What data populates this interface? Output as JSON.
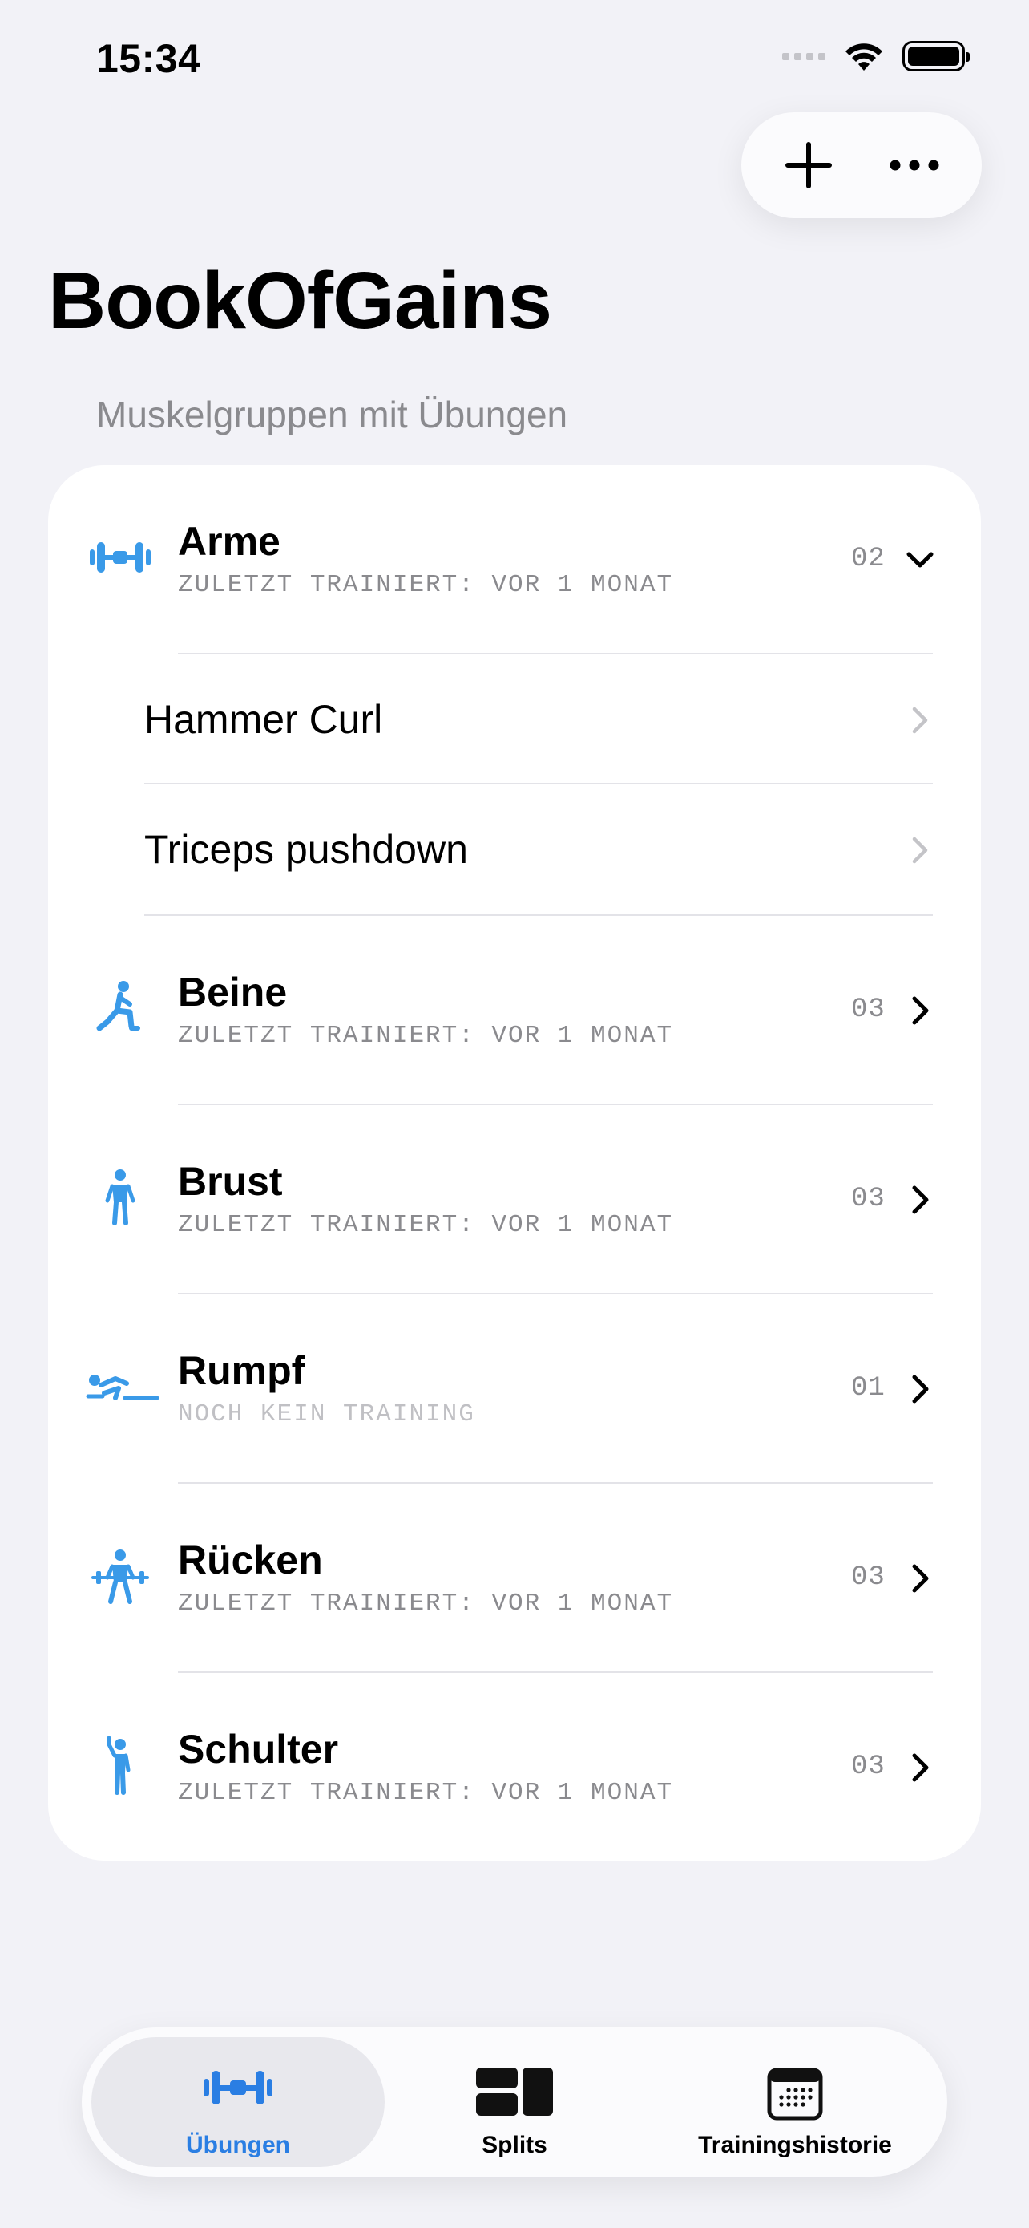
{
  "status_bar": {
    "time": "15:34"
  },
  "app": {
    "title": "BookOfGains"
  },
  "section_header": "Muskelgruppen mit Übungen",
  "groups": [
    {
      "name": "Arme",
      "subtitle": "ZULETZT TRAINIERT: VOR 1 MONAT",
      "count": "02",
      "expanded": true,
      "icon": "dumbbell-icon",
      "exercises": [
        {
          "name": "Hammer Curl"
        },
        {
          "name": "Triceps pushdown"
        }
      ]
    },
    {
      "name": "Beine",
      "subtitle": "ZULETZT TRAINIERT: VOR 1 MONAT",
      "count": "03",
      "icon": "lunge-figure-icon"
    },
    {
      "name": "Brust",
      "subtitle": "ZULETZT TRAINIERT: VOR 1 MONAT",
      "count": "03",
      "icon": "standing-figure-icon"
    },
    {
      "name": "Rumpf",
      "subtitle": "NOCH KEIN TRAINING",
      "count": "01",
      "icon": "core-training-figure-icon"
    },
    {
      "name": "Rücken",
      "subtitle": "ZULETZT TRAINIERT: VOR 1 MONAT",
      "count": "03",
      "icon": "barbell-lift-figure-icon"
    },
    {
      "name": "Schulter",
      "subtitle": "ZULETZT TRAINIERT: VOR 1 MONAT",
      "count": "03",
      "icon": "arm-raise-figure-icon"
    }
  ],
  "tabs": [
    {
      "label": "Übungen",
      "icon": "dumbbell-icon",
      "active": true
    },
    {
      "label": "Splits",
      "icon": "split-blocks-icon",
      "active": false
    },
    {
      "label": "Trainingshistorie",
      "icon": "calendar-icon",
      "active": false
    }
  ],
  "colors": {
    "accent": "#2a7ee3",
    "icon_blue": "#3a9ae8",
    "background": "#f2f2f7",
    "secondary_text": "#8a8a8e"
  }
}
